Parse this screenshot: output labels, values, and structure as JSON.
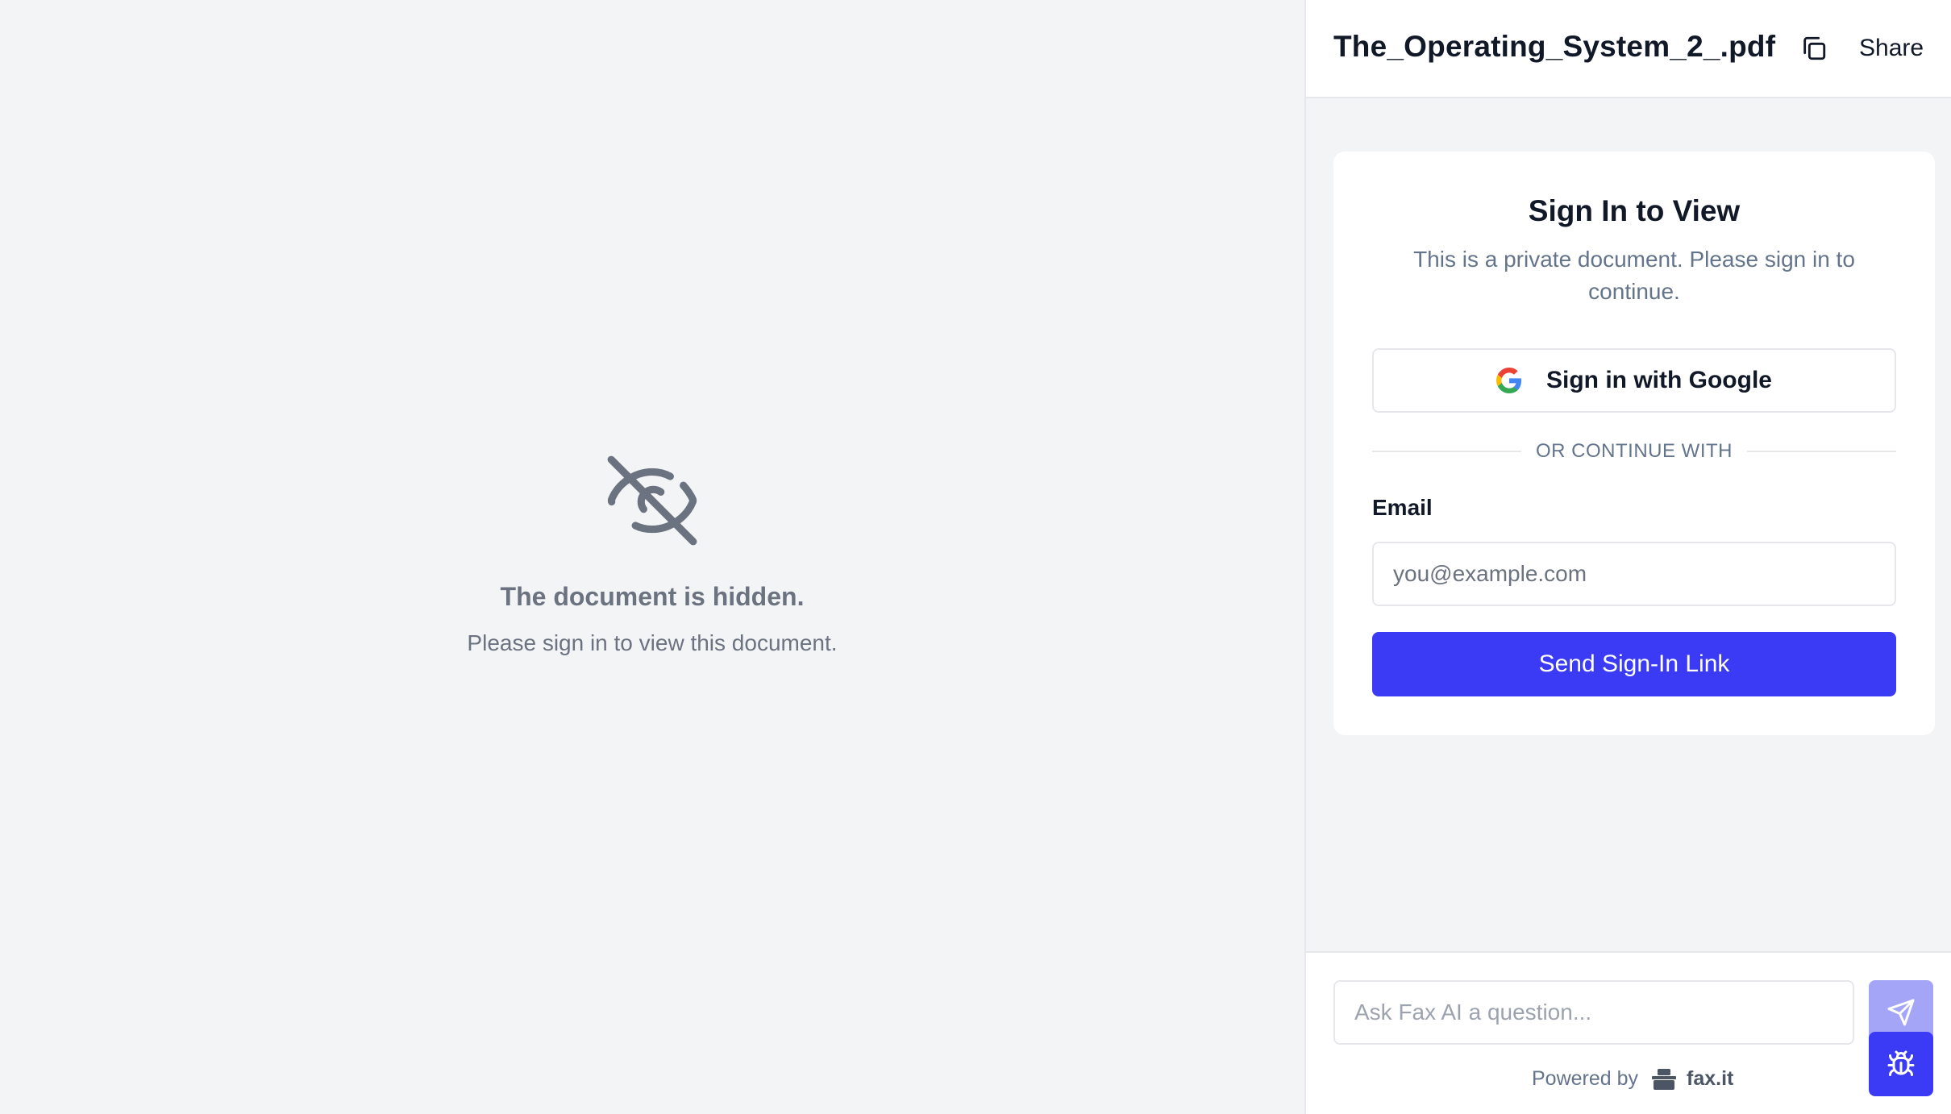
{
  "viewer": {
    "hidden_title": "The document is hidden.",
    "hidden_subtitle": "Please sign in to view this document.",
    "icon": "eye-off-icon"
  },
  "header": {
    "doc_title": "The_Operating_System_2_.pdf",
    "copy_icon": "copy-icon",
    "share_label": "Share"
  },
  "signin": {
    "title": "Sign In to View",
    "description": "This is a private document. Please sign in to continue.",
    "google_label": "Sign in with Google",
    "divider_label": "OR CONTINUE WITH",
    "email_label": "Email",
    "email_placeholder": "you@example.com",
    "email_value": "",
    "send_label": "Send Sign-In Link"
  },
  "ask": {
    "placeholder": "Ask Fax AI a question...",
    "send_icon": "send-icon",
    "bug_icon": "bug-icon",
    "powered_by": "Powered by",
    "brand": "fax.it"
  },
  "colors": {
    "accent": "#3b3bf5",
    "accent_disabled": "#a5a5f8",
    "muted_text": "#6b7280",
    "background": "#f3f4f6"
  }
}
